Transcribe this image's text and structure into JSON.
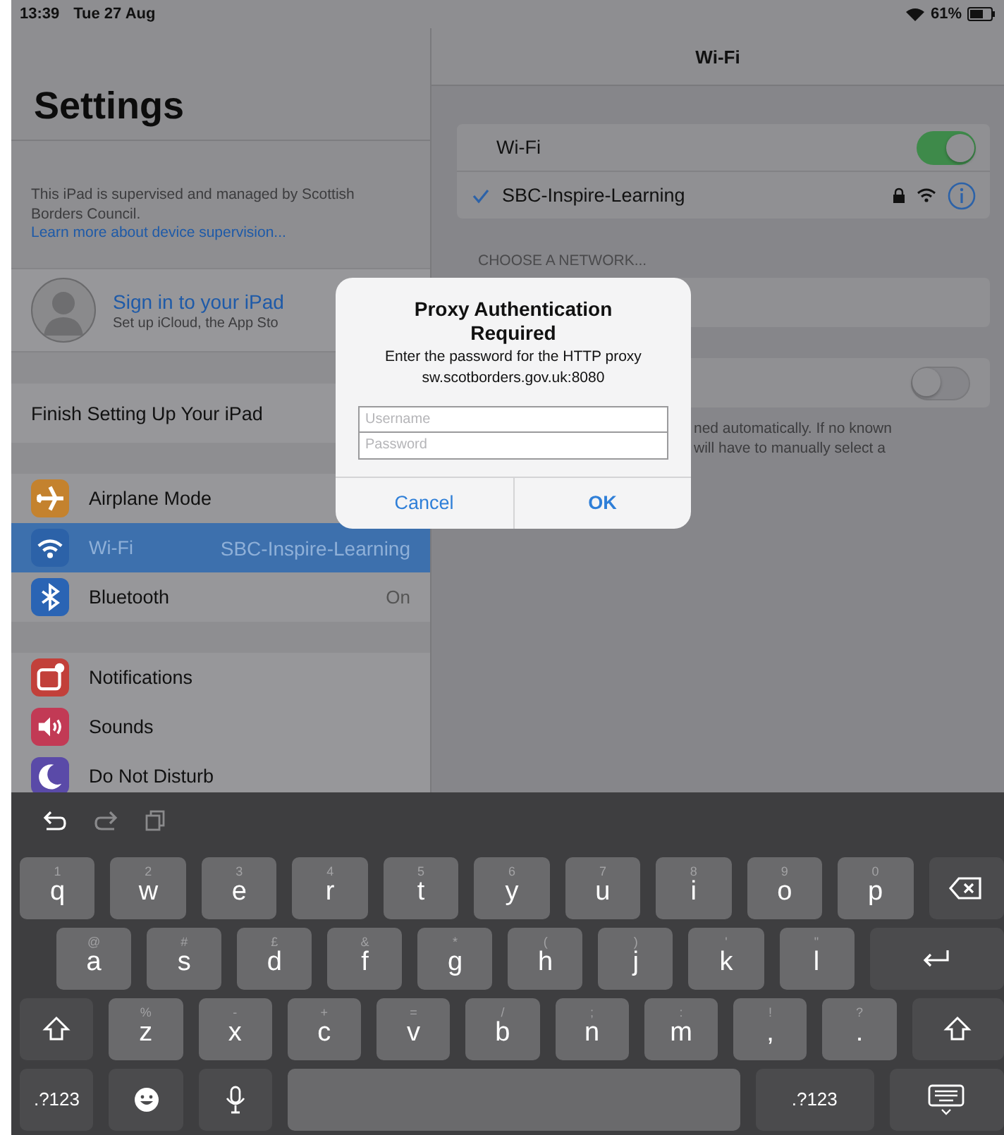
{
  "status_bar": {
    "time": "13:39",
    "date": "Tue 27 Aug",
    "battery": "61%"
  },
  "sidebar": {
    "title": "Settings",
    "supervision_note": {
      "text": "This iPad is supervised and managed by Scottish Borders Council.",
      "link": "Learn more about device supervision..."
    },
    "account": {
      "title": "Sign in to your iPad",
      "subtitle": "Set up iCloud, the App Sto"
    },
    "finish_setup": "Finish Setting Up Your iPad",
    "groups": [
      [
        {
          "kind": "airplane",
          "color": "#c4822e",
          "label": "Airplane Mode",
          "selected": false
        },
        {
          "kind": "wifi",
          "color": "#2c62a8",
          "label": "Wi-Fi",
          "value": "SBC-Inspire-Learning",
          "selected": true
        },
        {
          "kind": "bluetooth",
          "color": "#2a64b4",
          "label": "Bluetooth",
          "value": "On",
          "selected": false
        }
      ],
      [
        {
          "kind": "notifications",
          "color": "#c2403a",
          "label": "Notifications",
          "selected": false
        },
        {
          "kind": "sounds",
          "color": "#c23a55",
          "label": "Sounds",
          "selected": false
        },
        {
          "kind": "moon",
          "color": "#5a4aa8",
          "label": "Do Not Disturb",
          "selected": false
        }
      ]
    ]
  },
  "detail": {
    "title": "Wi-Fi",
    "wifi_toggle": {
      "label": "Wi-Fi",
      "on": true
    },
    "current_network": {
      "name": "SBC-Inspire-Learning",
      "checked": true,
      "locked": true
    },
    "section_header": "CHOOSE A NETWORK...",
    "ask_to_join": {
      "on": false
    },
    "footnote_lines": [
      "ned automatically. If no known",
      "will have to manually select a"
    ]
  },
  "dialog": {
    "title": "Proxy Authentication Required",
    "message_lines": [
      "Enter the password for the HTTP proxy",
      "sw.scotborders.gov.uk:8080"
    ],
    "fields": [
      {
        "placeholder": "Username"
      },
      {
        "placeholder": "Password"
      }
    ],
    "buttons": [
      {
        "label": "Cancel",
        "kind": "cancel"
      },
      {
        "label": "OK",
        "kind": "default"
      }
    ]
  },
  "keyboard": {
    "toolbar": [
      {
        "kind": "undo",
        "disabled": false
      },
      {
        "kind": "redo",
        "disabled": true
      },
      {
        "kind": "paste",
        "disabled": true
      }
    ],
    "rows": [
      [
        {
          "kind": "letter",
          "label": "q",
          "hint": "1"
        },
        {
          "kind": "letter",
          "label": "w",
          "hint": "2"
        },
        {
          "kind": "letter",
          "label": "e",
          "hint": "3"
        },
        {
          "kind": "letter",
          "label": "r",
          "hint": "4"
        },
        {
          "kind": "letter",
          "label": "t",
          "hint": "5"
        },
        {
          "kind": "letter",
          "label": "y",
          "hint": "6"
        },
        {
          "kind": "letter",
          "label": "u",
          "hint": "7"
        },
        {
          "kind": "letter",
          "label": "i",
          "hint": "8"
        },
        {
          "kind": "letter",
          "label": "o",
          "hint": "9"
        },
        {
          "kind": "letter",
          "label": "p",
          "hint": "0"
        },
        {
          "kind": "delete"
        }
      ],
      [
        {
          "kind": "letter",
          "label": "a",
          "hint": "@"
        },
        {
          "kind": "letter",
          "label": "s",
          "hint": "#"
        },
        {
          "kind": "letter",
          "label": "d",
          "hint": "£"
        },
        {
          "kind": "letter",
          "label": "f",
          "hint": "&"
        },
        {
          "kind": "letter",
          "label": "g",
          "hint": "*"
        },
        {
          "kind": "letter",
          "label": "h",
          "hint": "("
        },
        {
          "kind": "letter",
          "label": "j",
          "hint": ")"
        },
        {
          "kind": "letter",
          "label": "k",
          "hint": "'"
        },
        {
          "kind": "letter",
          "label": "l",
          "hint": "\""
        },
        {
          "kind": "return"
        }
      ],
      [
        {
          "kind": "shift"
        },
        {
          "kind": "letter",
          "label": "z",
          "hint": "%"
        },
        {
          "kind": "letter",
          "label": "x",
          "hint": "-"
        },
        {
          "kind": "letter",
          "label": "c",
          "hint": "+"
        },
        {
          "kind": "letter",
          "label": "v",
          "hint": "="
        },
        {
          "kind": "letter",
          "label": "b",
          "hint": "/"
        },
        {
          "kind": "letter",
          "label": "n",
          "hint": ";"
        },
        {
          "kind": "letter",
          "label": "m",
          "hint": ":"
        },
        {
          "kind": "punct",
          "label": ",",
          "hint": "!"
        },
        {
          "kind": "punct",
          "label": ".",
          "hint": "?"
        },
        {
          "kind": "shift"
        }
      ],
      [
        {
          "kind": "symbols",
          "label": ".?123"
        },
        {
          "kind": "emoji"
        },
        {
          "kind": "mic"
        },
        {
          "kind": "space"
        },
        {
          "kind": "symbols",
          "label": ".?123"
        },
        {
          "kind": "hide"
        }
      ]
    ]
  }
}
